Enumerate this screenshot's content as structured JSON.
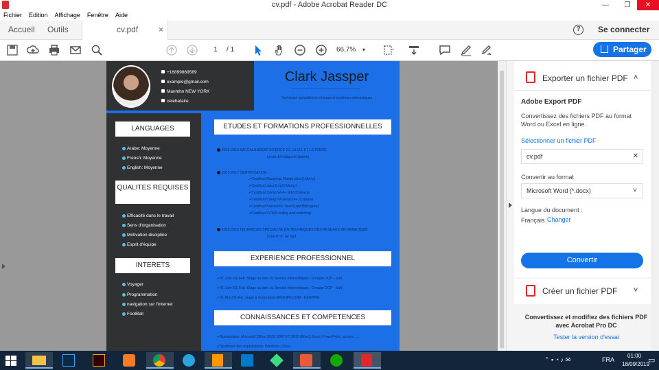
{
  "window": {
    "title": "cv.pdf - Adobe Acrobat Reader DC",
    "controls": {
      "minimize": "—",
      "restore": "❐",
      "close": "✕"
    }
  },
  "menubar": [
    "Fichier",
    "Edition",
    "Affichage",
    "Fenêtre",
    "Aide"
  ],
  "tabs": {
    "home": "Accueil",
    "tools": "Outils",
    "doc": "cv.pdf",
    "close": "×"
  },
  "header": {
    "help": "?",
    "signin": "Se connecter"
  },
  "toolbar": {
    "page_current": "1",
    "page_total": "/ 1",
    "zoom": "66,7%",
    "share_label": "Partager"
  },
  "cv": {
    "name": "Clark Jassper",
    "tagline": "Technicien spécialisé en réseaux et systèmes informatiques",
    "contact": [
      "+16899869589",
      "example@gmail.com",
      "Manhthn NEW YORK",
      "celebataire"
    ],
    "sidebar": {
      "languages_title": "LANGUAGES",
      "languages": [
        "Arabe: Moyenne",
        "Frensh: Moyenne",
        "English: Moyenne"
      ],
      "qualities_title": "QUALITES REQUISES",
      "qualities": [
        "Efficacité dans le travail",
        "Sens d'organisation",
        "Motivation discipline",
        "Esprit d'équipe"
      ],
      "interests_title": "INTERETS",
      "interests": [
        "Voyager",
        "Programmation",
        "navigation sur l'internet",
        "FootBall"
      ]
    },
    "sections": {
      "education_title": "ETUDES ET FORMATIONS PROFESSIONNELLES",
      "edu1": "2015-2016 BACCALAUREAT SCIENCE DE LA VIE ET LA TERRE",
      "edu1_sub": "Lycée Al Hidaya Al Islamia",
      "edu2": "2015-2017 CERTIFICATION",
      "certs": [
        "✔Certificat Bootstrap Masterclass(Udemy)",
        "✔Certificat JavaScript(Udemy)",
        "✔Certificat CompTIA A+ 902 (Cybrary)",
        "✔Certificat CompTIA Network+ (Cybrary)",
        "✔Certificat Interactive JavaScript(BitDegree)",
        "✔Certificat CCNA routing and switching"
      ],
      "edu3": "2015-2016 TECHNICIEN SPECIALISE EN TECHNIQUES DES RESEAUX INFORMATIQUE",
      "edu3_sub": "ISTA NTIC de Safi",
      "experience_title": "EXPERIENCE PROFESSIONNEL",
      "experience": [
        "✔01-Juin /01-Feb :Stage au sein du Service informatiques - Groupe OCP - Safi",
        "✔01-Juin /01-Feb :Stage au sein du Service informatiques - Groupe OCP - Safi",
        "✔01-Mai /01-Avr :stage à l'entreprise GROUPE COM - KENITRE"
      ],
      "skills_title": "CONNAISSANCES ET COMPETENCES",
      "skills": [
        "✔Bureautique: Microsoft Office 2003, 2007 ET 2010 (Word, Excel, PowerPoint, access ...)",
        "✔Systèmes des exploitations: Windows | Linux"
      ]
    }
  },
  "right_panel": {
    "export_title": "Exporter un fichier PDF",
    "chevron_up": "˄",
    "export_heading": "Adobe Export PDF",
    "export_desc": "Convertissez des fichiers PDF au format Word ou Excel en ligne.",
    "select_link": "Sélectionner un fichier PDF",
    "file_value": "cv.pdf",
    "file_clear": "✕",
    "convert_label": "Convertir au format",
    "format_value": "Microsoft Word (*.docx)",
    "format_chevron": "˅",
    "lang_label": "Langue du document :",
    "lang_value": "Français",
    "lang_change": "Changer",
    "convert_button": "Convertir",
    "create_title": "Créer un fichier PDF",
    "create_chevron": "˅",
    "promo": "Convertissez et modifiez des fichiers PDF avec Acrobat Pro DC",
    "promo_link": "Tester la version d'essai"
  },
  "taskbar": {
    "lang": "FRA",
    "time": "01:00",
    "date": "18/09/2019"
  },
  "colors": {
    "accent": "#1473e6",
    "cv_blue": "#1c6fe6",
    "cv_dark": "#303132",
    "taskbar": "#12253b"
  }
}
